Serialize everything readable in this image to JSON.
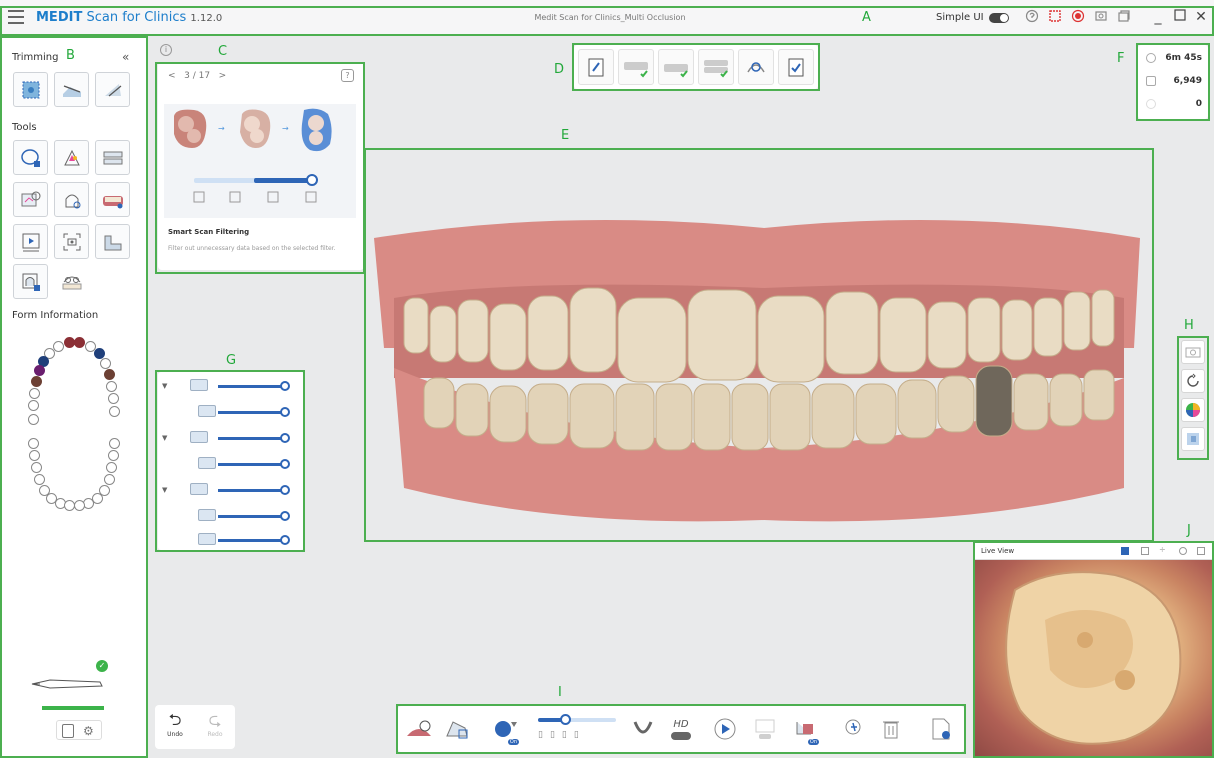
{
  "titlebar": {
    "brand": "MEDIT",
    "app_name": "Scan for Clinics",
    "version": "1.12.0",
    "document": "Medit Scan for Clinics_Multi Occlusion",
    "simple_ui_label": "Simple UI"
  },
  "left_panel": {
    "trimming_label": "Trimming",
    "tools_label": "Tools",
    "form_info_label": "Form Information"
  },
  "tip_card": {
    "page": "3 / 17",
    "prev": "<",
    "next": ">",
    "help": "?",
    "title": "Smart Scan Filtering",
    "description": "Filter out unnecessary data based on the selected filter."
  },
  "stats": {
    "time": "6m 45s",
    "count": "6,949",
    "third": "0"
  },
  "live_view": {
    "title": "Live View"
  },
  "undo": {
    "undo_label": "Undo",
    "redo_label": "Redo"
  },
  "bottom_toolbar": {
    "on_label": "On",
    "hd_label": "HD"
  },
  "annotations": {
    "A": "A",
    "B": "B",
    "C": "C",
    "D": "D",
    "E": "E",
    "F": "F",
    "G": "G",
    "H": "H",
    "I": "I",
    "J": "J"
  },
  "colors": {
    "accent": "#2e65b6",
    "annotation": "#4caf50",
    "brand": "#1d7ecb"
  }
}
